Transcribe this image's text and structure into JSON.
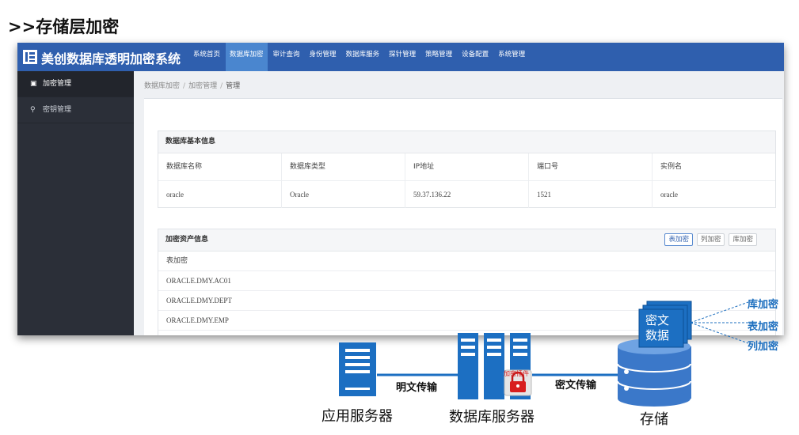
{
  "slide_title": ">>存储层加密",
  "app": {
    "title": "美创数据库透明加密系统",
    "nav": [
      {
        "label": "系统首页",
        "active": false
      },
      {
        "label": "数据库加密",
        "active": true
      },
      {
        "label": "审计查询",
        "active": false
      },
      {
        "label": "身份管理",
        "active": false
      },
      {
        "label": "数据库服务",
        "active": false
      },
      {
        "label": "探针管理",
        "active": false
      },
      {
        "label": "策略管理",
        "active": false
      },
      {
        "label": "设备配置",
        "active": false
      },
      {
        "label": "系统管理",
        "active": false
      }
    ]
  },
  "sidebar": {
    "items": [
      {
        "label": "加密管理",
        "icon": "lock-icon",
        "active": true
      },
      {
        "label": "密钥管理",
        "icon": "key-icon",
        "active": false
      }
    ]
  },
  "breadcrumb": [
    "数据库加密",
    "加密管理",
    "管理"
  ],
  "db_info": {
    "title": "数据库基本信息",
    "headers": [
      "数据库名称",
      "数据库类型",
      "IP地址",
      "端口号",
      "实例名"
    ],
    "values": [
      "oracle",
      "Oracle",
      "59.37.136.22",
      "1521",
      "oracle"
    ]
  },
  "asset_info": {
    "title": "加密资产信息",
    "buttons": [
      {
        "label": "表加密",
        "active": true
      },
      {
        "label": "列加密",
        "active": false
      },
      {
        "label": "库加密",
        "active": false
      }
    ],
    "list_header": "表加密",
    "rows": [
      "ORACLE.DMY.AC01",
      "ORACLE.DMY.DEPT",
      "ORACLE.DMY.EMP"
    ]
  },
  "diagram": {
    "app_server": "应用服务器",
    "db_server": "数据库服务器",
    "storage": "存储",
    "plain_transfer": "明文传输",
    "cipher_transfer": "密文传输",
    "plugin": "加密插件",
    "cipher_data": [
      "密文",
      "数据"
    ],
    "levels": [
      "库加密",
      "表加密",
      "列加密"
    ],
    "colors": {
      "blue": "#1d6fbf",
      "server_blue": "#1c6fc2",
      "storage_blue": "#3b78c9",
      "plugin_red": "#d81e1e"
    }
  }
}
